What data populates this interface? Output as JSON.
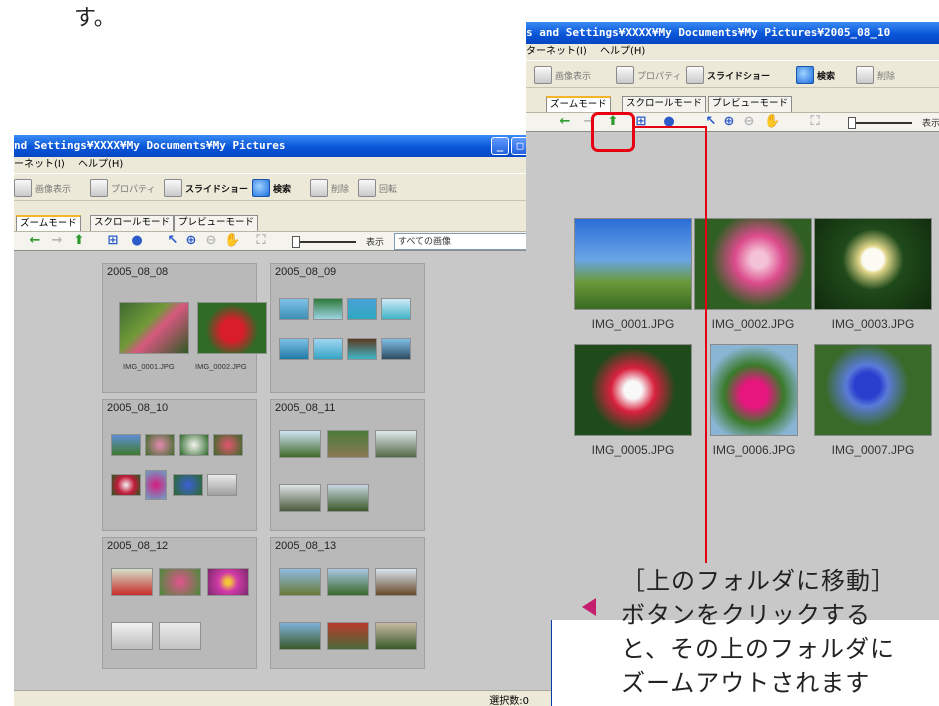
{
  "top_text": "す。",
  "left_window": {
    "title": "nd Settings¥XXXX¥My Documents¥My Pictures",
    "menu": [
      "ーネット(I)",
      "ヘルプ(H)"
    ],
    "toolbar": [
      "画像表示",
      "プロパティ",
      "スライドショー",
      "検索",
      "削除",
      "回転"
    ],
    "tabs": [
      "ズームモード",
      "スクロールモード",
      "プレビューモード"
    ],
    "nav": {
      "view_label": "表示",
      "filter_value": "すべての画像"
    },
    "groups": [
      {
        "title": "2005_08_08",
        "captions": [
          "IMG_0001.JPG",
          "IMG_0002.JPG"
        ]
      },
      {
        "title": "2005_08_09",
        "captions": []
      },
      {
        "title": "2005_08_10",
        "captions": []
      },
      {
        "title": "2005_08_11",
        "captions": []
      },
      {
        "title": "2005_08_12",
        "captions": []
      },
      {
        "title": "2005_08_13",
        "captions": []
      }
    ],
    "status": "選択数:0"
  },
  "right_window": {
    "title": "s and Settings¥XXXX¥My Documents¥My Pictures¥2005_08_10",
    "menu": [
      "ターネット(I)",
      "ヘルプ(H)"
    ],
    "toolbar": [
      "画像表示",
      "プロパティ",
      "スライドショー",
      "検索",
      "削除"
    ],
    "tabs": [
      "ズームモード",
      "スクロールモード",
      "プレビューモード"
    ],
    "nav": {
      "view_label": "表示"
    },
    "photos": [
      {
        "caption": "IMG_0001.JPG"
      },
      {
        "caption": "IMG_0002.JPG"
      },
      {
        "caption": "IMG_0003.JPG"
      },
      {
        "caption": "IMG_0005.JPG"
      },
      {
        "caption": "IMG_0006.JPG"
      },
      {
        "caption": "IMG_0007.JPG"
      }
    ]
  },
  "callout": {
    "lines": [
      "［上のフォルダに移動］",
      "ボタンをクリックする",
      "と、その上のフォルダに",
      "ズームアウトされます"
    ]
  },
  "colors": {
    "highlight": "#e60012",
    "pointer": "#c41e6e",
    "titlebar": "#0a56d8"
  }
}
